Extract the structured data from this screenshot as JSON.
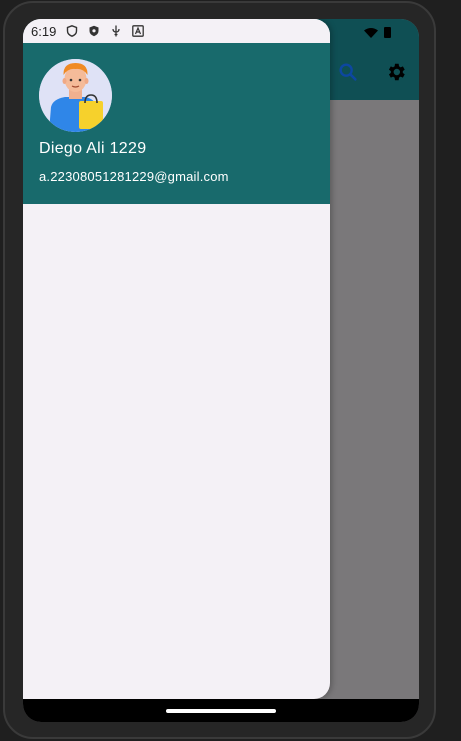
{
  "status_bar": {
    "time": "6:19",
    "icons": [
      "shield-outline-icon",
      "shield-filled-icon",
      "usb-icon",
      "text-a-icon"
    ],
    "right_icons": [
      "wifi-icon",
      "battery-icon"
    ]
  },
  "app_bar": {
    "actions": [
      "search-icon",
      "settings-icon"
    ]
  },
  "drawer": {
    "header": {
      "avatar": "avatar-shopper-icon",
      "name": "Diego Ali 1229",
      "email": "a.22308051281229@gmail.com"
    }
  },
  "colors": {
    "drawer_header": "#186a6c",
    "drawer_bg": "#f4f1f6",
    "scrim": "#7a787a"
  }
}
